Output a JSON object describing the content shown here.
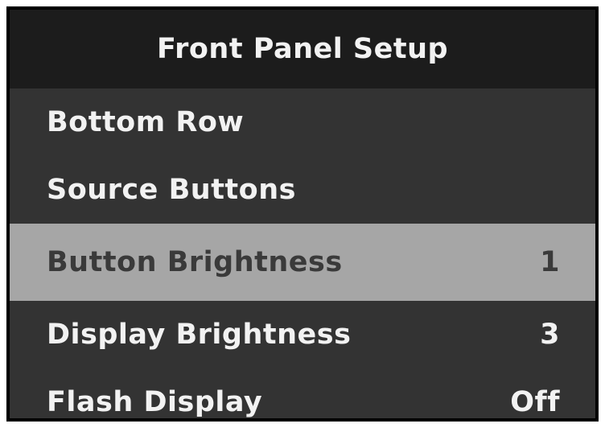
{
  "title": "Front Panel Setup",
  "items": [
    {
      "label": "Bottom Row",
      "value": ""
    },
    {
      "label": "Source Buttons",
      "value": ""
    },
    {
      "label": "Button Brightness",
      "value": "1",
      "selected": true
    },
    {
      "label": "Display Brightness",
      "value": "3"
    },
    {
      "label": "Flash Display",
      "value": "Off"
    }
  ],
  "colors": {
    "background": "#333333",
    "title_bar": "#1c1c1c",
    "selected_row": "#a6a6a6",
    "text": "#f2f2f2",
    "selected_text": "#3a3a3a"
  }
}
